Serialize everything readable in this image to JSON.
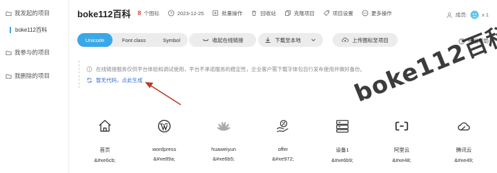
{
  "sidebar": {
    "created": "我发起的项目",
    "active_project": "boke112百科",
    "joined": "我参与的项目",
    "deleted": "我删除的项目"
  },
  "header": {
    "title": "boke112百科",
    "icon_count": "8",
    "icon_count_label": "个图标",
    "date": "2023-12-25",
    "batch": "批量操作",
    "recycle": "回收站",
    "clone": "克隆项目",
    "settings": "项目设置",
    "more": "更多操作",
    "members_label": "成员:",
    "members_count": "x 1"
  },
  "toolbar": {
    "tabs": [
      "Unicode",
      "Font class",
      "Symbol"
    ],
    "active_tab": "Unicode",
    "collapse_link": "收起在线链接",
    "download": "下载至本地",
    "upload": "上传图标至项目",
    "help": "使用帮助"
  },
  "notice": {
    "text": "在线链接服务仅供平台体验和调试使用，平台不承诺服务的稳定性，企业客户需下载字体包自行发布使用并做好备份。",
    "generate": "暂无代码，点此生成"
  },
  "icons": [
    {
      "name": "首页",
      "code": "&#xe6cb;",
      "icon": "home-icon"
    },
    {
      "name": "wordpress",
      "code": "&#xe89a;",
      "icon": "wordpress-icon"
    },
    {
      "name": "huaweiyun",
      "code": "&#xe6b5;",
      "icon": "huawei-icon"
    },
    {
      "name": "offer",
      "code": "&#xe972;",
      "icon": "offer-icon"
    },
    {
      "name": "设备1",
      "code": "&#xe6b9;",
      "icon": "server-icon"
    },
    {
      "name": "阿里云",
      "code": "&#xe48;",
      "icon": "aliyun-icon"
    },
    {
      "name": "腾讯云",
      "code": "&#xe49;",
      "icon": "tencent-cloud-icon"
    }
  ],
  "watermark": "boke112百科",
  "colors": {
    "accent": "#3aa8e6",
    "count": "#e0473c",
    "link": "#2f6fd6",
    "arrow": "#c0392b"
  }
}
